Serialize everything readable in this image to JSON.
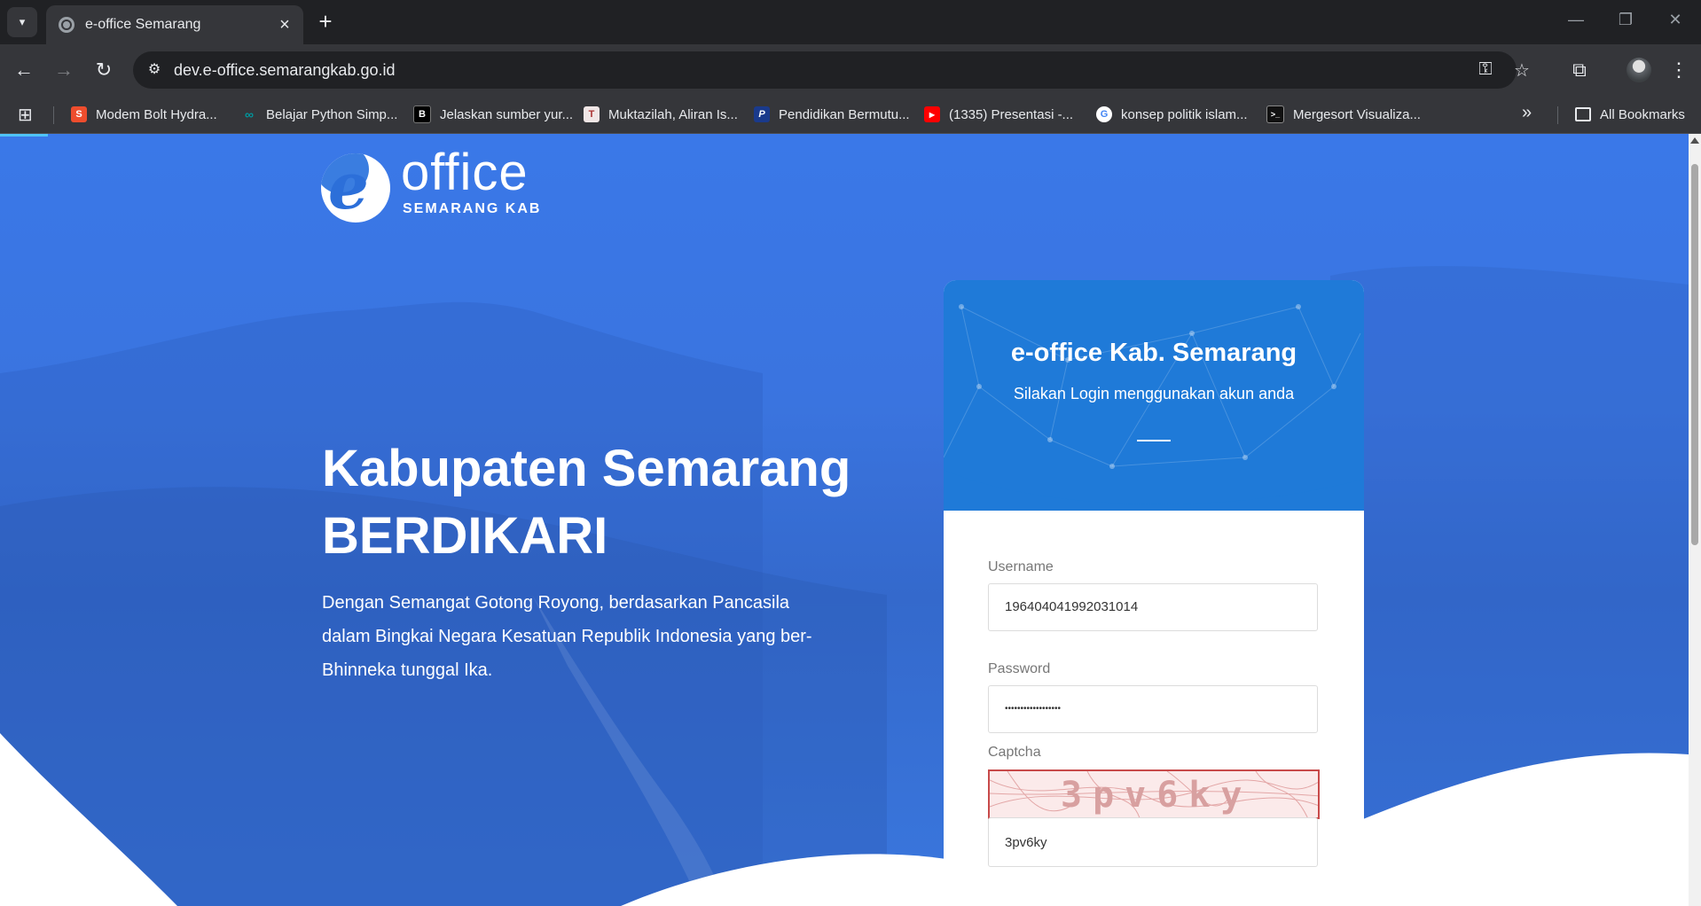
{
  "browser": {
    "tab_title": "e-office Semarang",
    "url": "dev.e-office.semarangkab.go.id",
    "bookmarks": [
      {
        "label": "Modem Bolt Hydra...",
        "color": "#ee4d2d",
        "icon": "shopee-icon"
      },
      {
        "label": "Belajar Python Simp...",
        "color": "#00979d",
        "icon": "arduino-icon"
      },
      {
        "label": "Jelaskan sumber yur...",
        "color": "#000000",
        "icon": "b-icon"
      },
      {
        "label": "Muktazilah, Aliran Is...",
        "color": "#f0e6e6",
        "icon": "t-icon"
      },
      {
        "label": "Pendidikan Bermutu...",
        "color": "#1a3a8c",
        "icon": "p-icon"
      },
      {
        "label": "(1335) Presentasi -...",
        "color": "#ff0000",
        "icon": "youtube-icon"
      },
      {
        "label": "konsep politik islam...",
        "color": "#ffffff",
        "icon": "google-icon"
      },
      {
        "label": "Mergesort Visualiza...",
        "color": "#111111",
        "icon": "terminal-icon"
      }
    ],
    "all_bookmarks_label": "All Bookmarks"
  },
  "logo": {
    "letter": "e",
    "word": "office",
    "subtitle": "SEMARANG KAB"
  },
  "hero": {
    "title_line1": "Kabupaten Semarang",
    "title_line2": "BERDIKARI",
    "text": "Dengan Semangat Gotong Royong, berdasarkan Pancasila dalam Bingkai Negara Kesatuan Republik Indonesia yang ber-Bhinneka tunggal Ika."
  },
  "login": {
    "title": "e-office Kab. Semarang",
    "subtitle": "Silakan Login menggunakan akun anda",
    "username_label": "Username",
    "username_value": "196404041992031014",
    "password_label": "Password",
    "password_value": "••••••••••••••••••",
    "captcha_label": "Captcha",
    "captcha_image_text": "3pv6ky",
    "captcha_value": "3pv6ky"
  },
  "colors": {
    "header_blue": "#1f7ad8",
    "page_blue": "#3a78e8",
    "captcha_border": "#c84a4a"
  }
}
